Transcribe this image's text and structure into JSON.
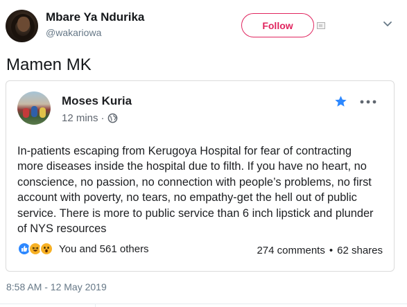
{
  "tweet": {
    "author_name": "Mbare Ya Ndurika",
    "author_handle": "@wakariowa",
    "follow_label": "Follow",
    "text": "Mamen MK",
    "timestamp": "8:58 AM - 12 May 2019"
  },
  "embedded_post": {
    "author": "Moses Kuria",
    "time": "12 mins",
    "time_separator": "·",
    "body_lines": [
      "In-patients escaping from Kerugoya Hospital for fear of contracting",
      "more diseases inside the hospital due to filth. If you have no heart, no",
      "conscience, no passion, no connection with people’s problems, no first",
      "account with poverty, no tears, no empathy-get the hell out of public",
      "service. There is more to public service than 6 inch lipstick and plunder",
      "of NYS resources"
    ],
    "reactions_text": "You and 561 others",
    "comments": "274 comments",
    "separator": "•",
    "shares": "62 shares"
  },
  "colors": {
    "follow": "#e0245e",
    "star": "#2d88ff",
    "like": "#2d88ff",
    "haha": "#f7b125",
    "secondary_text": "#657786"
  },
  "icons": [
    "chevron-down-icon",
    "globe-icon",
    "star-icon",
    "more-icon",
    "like-reaction-icon",
    "haha-reaction-icon",
    "wow-reaction-icon"
  ]
}
